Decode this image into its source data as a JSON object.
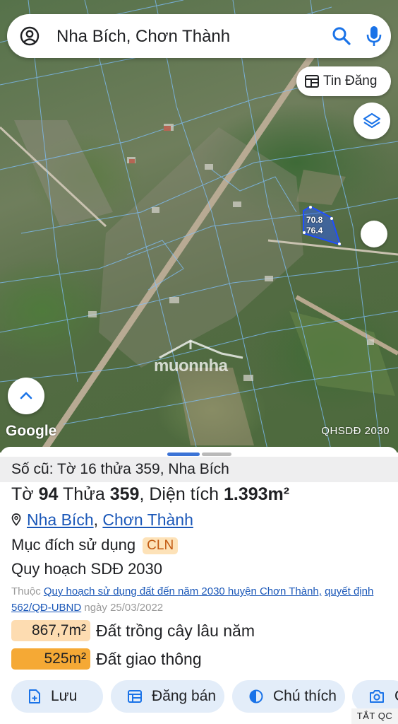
{
  "search": {
    "query": "Nha Bích, Chơn Thành"
  },
  "map": {
    "news_button_label": "Tin Đăng",
    "parcel_dims": [
      "70.8",
      "76.4"
    ],
    "google_label": "Google",
    "plan_label": "QHSDĐ 2030",
    "watermark_text": "muonnha"
  },
  "sheet": {
    "old_info": "Số cũ: Tờ 16 thửa 359, Nha Bích",
    "title": {
      "to_label": "Tờ",
      "to_value": "94",
      "thua_label": "Thửa",
      "thua_value": "359",
      "area_label": "Diện tích",
      "area_value": "1.393m²"
    },
    "location": {
      "commune": "Nha Bích",
      "separator": ",",
      "district": "Chơn Thành"
    },
    "purpose": {
      "label": "Mục đích sử dụng",
      "code": "CLN"
    },
    "plan_title": "Quy hoạch SDĐ 2030",
    "belong": {
      "prefix": "Thuộc",
      "plan_link": "Quy hoạch sử dụng đất đến năm 2030 huyện Chơn Thành,",
      "decision_link": "quyết định 562/QĐ-UBND",
      "date_text": "ngày 25/03/2022"
    },
    "areas": [
      {
        "value": "867,7m²",
        "label": "Đất trồng cây lâu năm",
        "color": "#fddcb1"
      },
      {
        "value": "525m²",
        "label": "Đất giao thông",
        "color": "#f5a935"
      }
    ],
    "actions": {
      "save": "Lưu",
      "post": "Đăng bán",
      "legend": "Chú thích",
      "capture": "C"
    },
    "ad_tag": "TẮT QC"
  },
  "colors": {
    "accent": "#1a73e8",
    "link": "#1a57b8",
    "badge_bg": "#fde2b8",
    "badge_text": "#c25a12",
    "action_bg": "#e3edf9"
  }
}
